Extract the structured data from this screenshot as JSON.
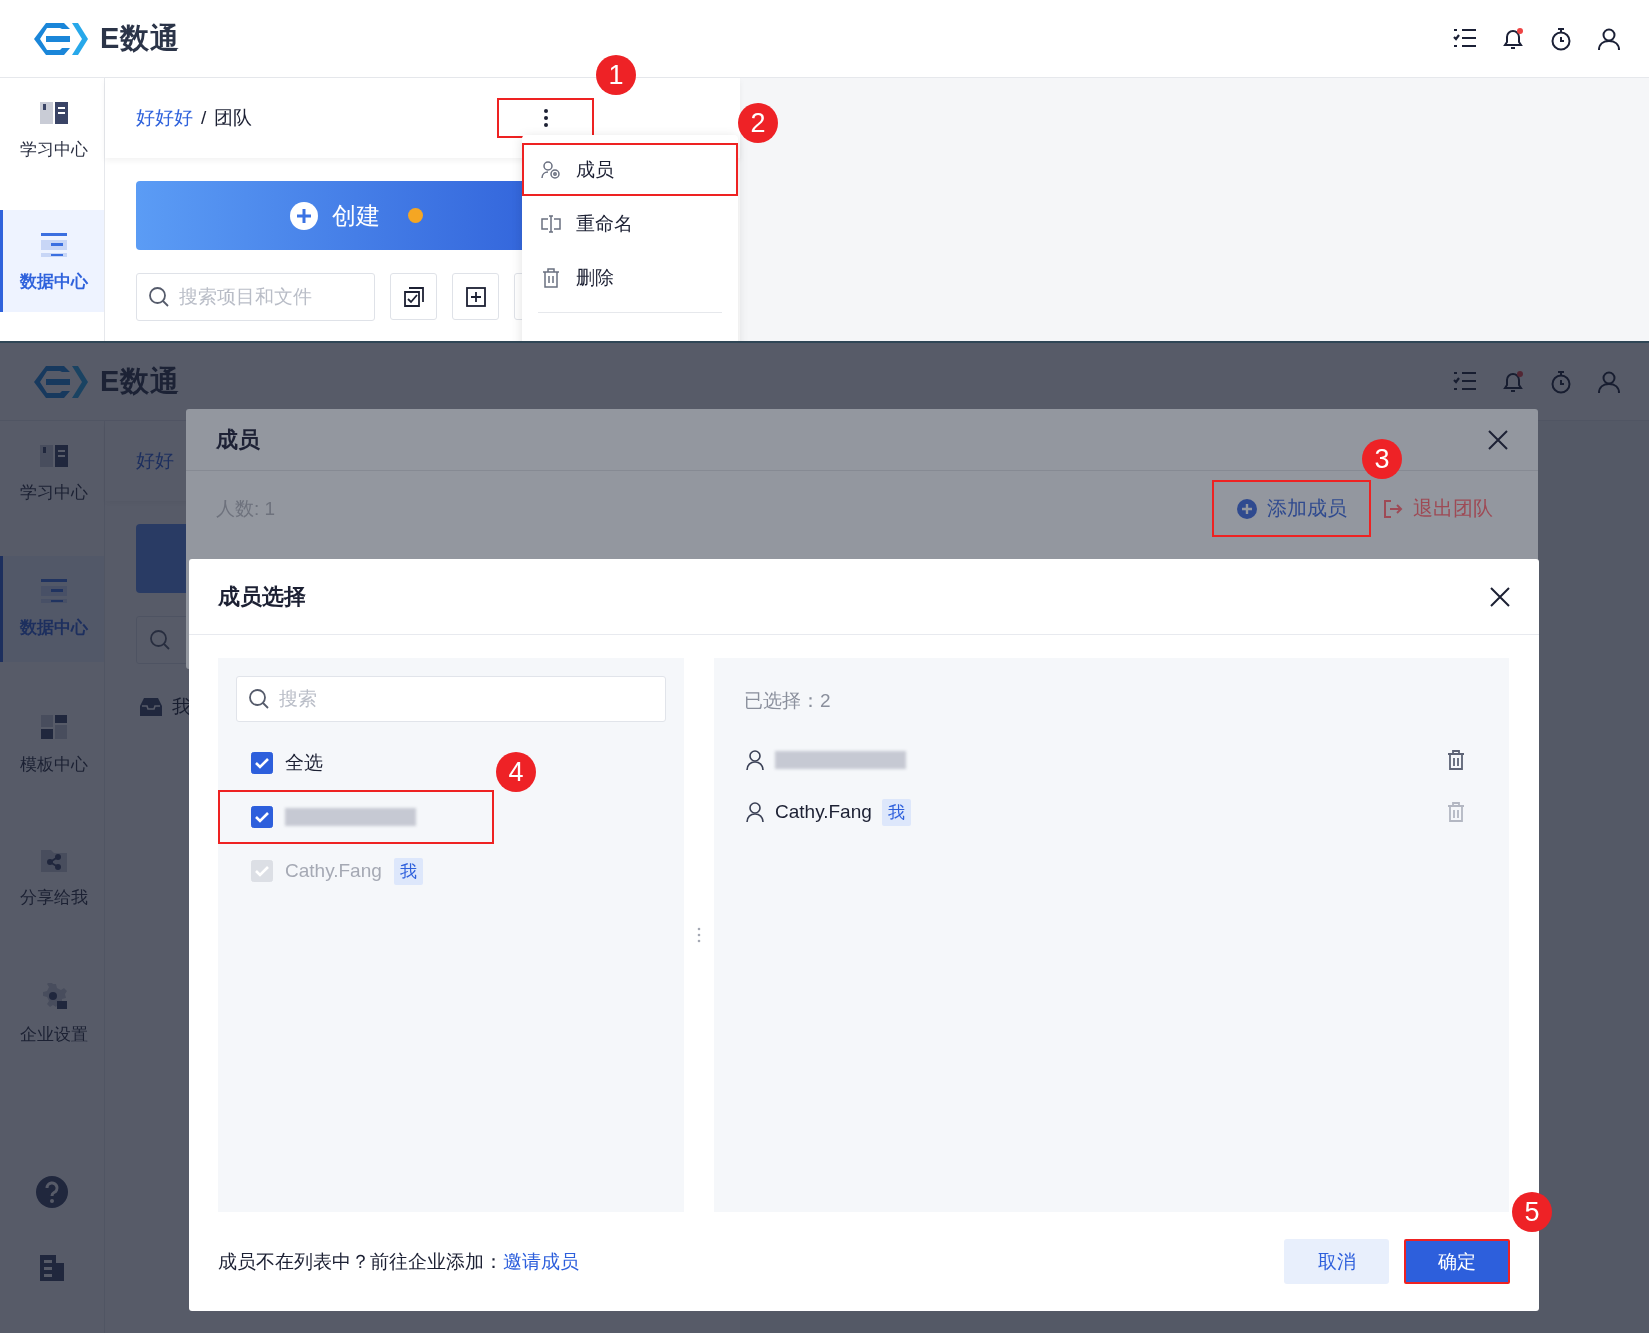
{
  "top_screen": {
    "header": {
      "logo_text": "E数通",
      "notification_dot": true
    },
    "sidebar": [
      {
        "kind": "learning",
        "label": "学习中心",
        "selected": false
      },
      {
        "kind": "data",
        "label": "数据中心",
        "selected": true
      }
    ],
    "breadcrumb": {
      "parent": "好好好",
      "separator": "/",
      "current": "团队"
    },
    "more_button": {
      "highlighted": true
    },
    "create_button": {
      "label": "创建",
      "dot": true
    },
    "search": {
      "placeholder": "搜索项目和文件"
    },
    "menu": [
      {
        "kind": "members",
        "label": "成员",
        "highlighted": true
      },
      {
        "kind": "rename",
        "label": "重命名",
        "highlighted": false
      },
      {
        "kind": "delete",
        "label": "删除",
        "highlighted": false
      }
    ],
    "callouts": [
      "1",
      "2"
    ]
  },
  "bottom_screen": {
    "header": {
      "logo_text": "E数通",
      "notification_dot": true
    },
    "sidebar": [
      {
        "kind": "learning",
        "label": "学习中心",
        "selected": false
      },
      {
        "kind": "data",
        "label": "数据中心",
        "selected": true
      },
      {
        "kind": "template",
        "label": "模板中心",
        "selected": false
      },
      {
        "kind": "shared",
        "label": "分享给我",
        "selected": false
      },
      {
        "kind": "settings",
        "label": "企业设置",
        "selected": false
      }
    ],
    "breadcrumb_fragment": "好好",
    "folder_label": "我",
    "members_dialog": {
      "title": "成员",
      "count": "人数: 1",
      "add_button": {
        "label": "添加成员",
        "highlighted": true
      },
      "exit_button": {
        "label": "退出团队"
      }
    },
    "select_dialog": {
      "title": "成员选择",
      "search": {
        "placeholder": "搜索"
      },
      "select_all": {
        "label": "全选",
        "checked": true
      },
      "candidates": [
        {
          "kind": "redacted",
          "checked": true,
          "disabled": false,
          "highlighted": true
        },
        {
          "kind": "named",
          "name": "Cathy.Fang",
          "tag": "我",
          "checked": true,
          "disabled": true,
          "highlighted": false
        }
      ],
      "chosen_count": "已选择：2",
      "chosen_members": [
        {
          "kind": "redacted",
          "removable": true
        },
        {
          "kind": "named",
          "name": "Cathy.Fang",
          "tag": "我",
          "removable": false
        }
      ],
      "footer_text": "成员不在列表中？前往企业添加：",
      "invite_link": "邀请成员",
      "cancel_button": "取消",
      "confirm_button": {
        "label": "确定",
        "highlighted": true
      }
    },
    "callouts": [
      "3",
      "4",
      "5"
    ]
  }
}
